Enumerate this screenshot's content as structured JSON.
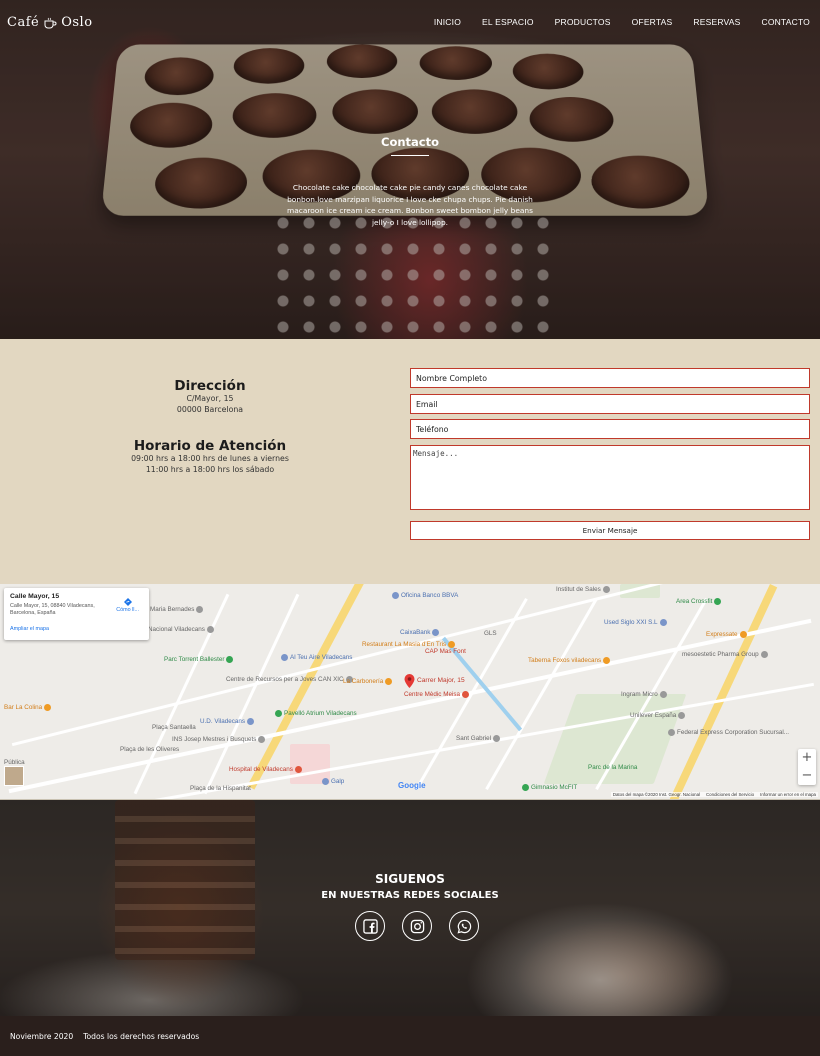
{
  "brand": {
    "name_left": "Café",
    "name_right": "Oslo"
  },
  "nav": {
    "items": [
      "INICIO",
      "EL ESPACIO",
      "PRODUCTOS",
      "OFERTAS",
      "RESERVAS",
      "CONTACTO"
    ]
  },
  "hero": {
    "title": "Contacto",
    "text": "Chocolate cake chocolate cake pie candy canes chocolate cake bonbon.love marzipan liquorice I love cke chupa chups. Pie danish macaroon ice cream ice cream. Bonbon sweet bombon jelly beans jelly-o I love lollipop."
  },
  "contact": {
    "address_title": "Dirección",
    "address_line1": "C/Mayor, 15",
    "address_line2": "00000 Barcelona",
    "hours_title": "Horario de Atención",
    "hours_line1": "09:00 hrs a 18:00 hrs de lunes a viernes",
    "hours_line2": "11:00 hrs a 18:00 hrs los sábado"
  },
  "form": {
    "name_placeholder": "Nombre Completo",
    "email_placeholder": "Email",
    "phone_placeholder": "Teléfono",
    "message_placeholder": "Mensaje...",
    "submit_label": "Enviar Mensaje"
  },
  "map": {
    "card_title": "Calle Mayor, 15",
    "card_address": "Calle Mayor, 15, 08840 Viladecans, Barcelona, España",
    "card_directions": "Cómo ll...",
    "card_link": "Ampliar el mapa",
    "marker_label": "Carrer Major, 15",
    "google": "Google",
    "attribution": [
      "Datos del mapa ©2020 Inst. Geogr. Nacional",
      "Condiciones del Servicio",
      "Informar un error en el mapa"
    ],
    "pois": [
      {
        "label": "Oficina Banco BBVA",
        "color": "blue"
      },
      {
        "label": "Institut de Sales",
        "color": "gray"
      },
      {
        "label": "Area Crossfit",
        "color": "green"
      },
      {
        "label": "Used Siglo XXI S.L",
        "color": "blue"
      },
      {
        "label": "Expressate",
        "color": "orange"
      },
      {
        "label": "Maria Bernades",
        "color": "gray"
      },
      {
        "label": "Nacional Viladecans",
        "color": "gray"
      },
      {
        "label": "CaixaBank",
        "color": "blue"
      },
      {
        "label": "GLS",
        "color": "gray"
      },
      {
        "label": "Restaurant La Masia d'En Tris",
        "color": "orange"
      },
      {
        "label": "CAP Mas Font",
        "color": "red"
      },
      {
        "label": "Taberna Foxos viladecans",
        "color": "orange"
      },
      {
        "label": "mesoestetic Pharma Group",
        "color": "gray"
      },
      {
        "label": "Parc Torrent Ballester",
        "color": "green"
      },
      {
        "label": "Al Teu Aire Viladecans",
        "color": "blue"
      },
      {
        "label": "Centre de Recursos per a Joves CAN XIC",
        "color": "gray"
      },
      {
        "label": "La Carbonería",
        "color": "orange"
      },
      {
        "label": "Centre Mèdic Meisa",
        "color": "red"
      },
      {
        "label": "Ingram Micro",
        "color": "gray"
      },
      {
        "label": "Bar La Colina",
        "color": "orange"
      },
      {
        "label": "Pavelló Atrium Viladecans",
        "color": "green"
      },
      {
        "label": "Plaça Santaella",
        "color": "gray"
      },
      {
        "label": "U.D. Viladecans",
        "color": "blue"
      },
      {
        "label": "Unilever España",
        "color": "gray"
      },
      {
        "label": "INS Josep Mestres i Busquets",
        "color": "gray"
      },
      {
        "label": "Sant Gabriel",
        "color": "gray"
      },
      {
        "label": "Federal Express Corporation Sucursal...",
        "color": "gray"
      },
      {
        "label": "Plaça de les Oliveres",
        "color": "gray"
      },
      {
        "label": "Hospital de Viladecans",
        "color": "red"
      },
      {
        "label": "Galp",
        "color": "blue"
      },
      {
        "label": "Parc de la Marina",
        "color": "green"
      },
      {
        "label": "Gimnasio McFIT",
        "color": "green"
      },
      {
        "label": "Plaça de la Hispanitat",
        "color": "gray"
      },
      {
        "label": "Pública",
        "color": "gray"
      }
    ]
  },
  "social": {
    "title": "SIGUENOS",
    "subtitle": "EN NUESTRAS REDES SOCIALES",
    "icons": [
      "facebook-icon",
      "instagram-icon",
      "whatsapp-icon"
    ]
  },
  "footer": {
    "date": "Noviembre 2020",
    "rights": "Todos los derechos reservados"
  }
}
